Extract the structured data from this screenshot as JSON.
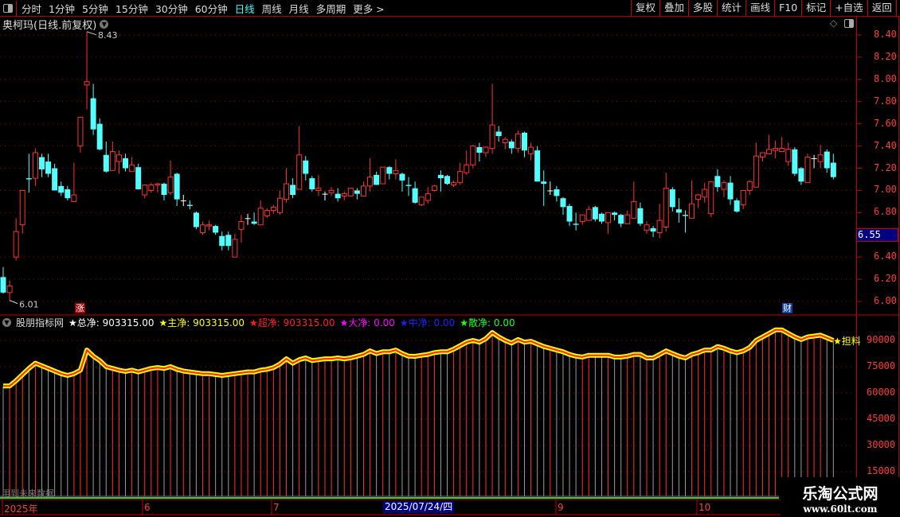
{
  "toolbar": {
    "periods": [
      "分时",
      "1分钟",
      "5分钟",
      "15分钟",
      "30分钟",
      "60分钟",
      "日线",
      "周线",
      "月线",
      "多周期",
      "更多 >"
    ],
    "active_period": "日线",
    "buttons": [
      "复权",
      "叠加",
      "多股",
      "统计",
      "画线",
      "F10",
      "标记",
      "+自选",
      "返回"
    ]
  },
  "chart": {
    "title": "奥柯玛(日线.前复权)",
    "high_marker": "8.43",
    "low_marker": "6.01",
    "signal_up": "涨",
    "signal_fin": "财",
    "current_price_label": "6.55",
    "price_ticks": [
      "8.40",
      "8.20",
      "8.00",
      "7.80",
      "7.60",
      "7.40",
      "7.20",
      "7.00",
      "6.80",
      "6.40",
      "6.20",
      "6.00"
    ],
    "colors": {
      "up": "#ff3232",
      "down": "#54ffff",
      "doji": "#ffffff",
      "grid": "#a00000",
      "axis": "#c00000"
    }
  },
  "indicator": {
    "name": "股朋指标网",
    "fields": [
      {
        "label": "★总净:",
        "value": "903315.00",
        "color": "#ffffff"
      },
      {
        "label": "★主净:",
        "value": "903315.00",
        "color": "#ffff00"
      },
      {
        "label": "★超净:",
        "value": "903315.00",
        "color": "#ff2020"
      },
      {
        "label": "★大净:",
        "value": "0.00",
        "color": "#ff00ff"
      },
      {
        "label": "★中净:",
        "value": "0.00",
        "color": "#2020ff"
      },
      {
        "label": "★散净:",
        "value": "0.00",
        "color": "#20ff20"
      }
    ],
    "end_label": "★担料",
    "ticks": [
      "90000",
      "75000",
      "60000",
      "45000",
      "30000",
      "15000"
    ],
    "note": "用到未来数据"
  },
  "date_axis": {
    "labels": [
      "2025年",
      "6",
      "7",
      "9",
      "10"
    ],
    "cursor_date": "2025/07/24/四"
  },
  "watermark": {
    "name": "乐淘公式网",
    "url": "www.60lt.com"
  },
  "chart_data": {
    "type": "candlestick",
    "price_range": [
      5.95,
      8.55
    ],
    "ohlc": [
      [
        6.22,
        6.31,
        6.07,
        6.08
      ],
      [
        6.08,
        6.19,
        6.01,
        6.14
      ],
      [
        6.4,
        6.75,
        6.37,
        6.63
      ],
      [
        6.69,
        7.0,
        6.61,
        7.0
      ],
      [
        7.11,
        7.33,
        6.98,
        7.1
      ],
      [
        7.11,
        7.38,
        7.04,
        7.34
      ],
      [
        7.3,
        7.33,
        7.12,
        7.19
      ],
      [
        7.26,
        7.33,
        7.12,
        7.15
      ],
      [
        7.2,
        7.24,
        7.0,
        7.0
      ],
      [
        7.04,
        7.08,
        6.95,
        6.98
      ],
      [
        7.01,
        7.04,
        6.91,
        6.93
      ],
      [
        6.9,
        7.25,
        6.9,
        6.96
      ],
      [
        7.4,
        7.66,
        7.34,
        7.66
      ],
      [
        7.95,
        8.43,
        7.73,
        7.98
      ],
      [
        7.83,
        7.96,
        7.5,
        7.55
      ],
      [
        7.6,
        7.65,
        7.36,
        7.37
      ],
      [
        7.32,
        7.44,
        7.16,
        7.17
      ],
      [
        7.18,
        7.44,
        7.18,
        7.35
      ],
      [
        7.26,
        7.36,
        7.15,
        7.32
      ],
      [
        7.29,
        7.33,
        7.17,
        7.2
      ],
      [
        7.17,
        7.3,
        7.17,
        7.23
      ],
      [
        7.21,
        7.24,
        7.01,
        7.01
      ],
      [
        6.96,
        7.05,
        6.93,
        7.05
      ],
      [
        7.0,
        7.07,
        6.98,
        7.05
      ],
      [
        7.05,
        7.07,
        6.98,
        7.06
      ],
      [
        7.06,
        7.07,
        6.91,
        6.96
      ],
      [
        6.98,
        7.27,
        6.96,
        7.12
      ],
      [
        7.15,
        7.16,
        6.86,
        6.92
      ],
      [
        6.91,
        6.96,
        6.86,
        6.91
      ],
      [
        6.87,
        6.91,
        6.83,
        6.86
      ],
      [
        6.8,
        6.81,
        6.65,
        6.67
      ],
      [
        6.62,
        6.72,
        6.6,
        6.69
      ],
      [
        6.68,
        6.73,
        6.64,
        6.69
      ],
      [
        6.68,
        6.69,
        6.6,
        6.62
      ],
      [
        6.59,
        6.63,
        6.46,
        6.5
      ],
      [
        6.6,
        6.63,
        6.46,
        6.5
      ],
      [
        6.4,
        6.61,
        6.4,
        6.56
      ],
      [
        6.65,
        6.78,
        6.53,
        6.72
      ],
      [
        6.75,
        6.79,
        6.69,
        6.75
      ],
      [
        6.72,
        6.8,
        6.69,
        6.7
      ],
      [
        6.69,
        6.91,
        6.69,
        6.84
      ],
      [
        6.77,
        6.84,
        6.75,
        6.82
      ],
      [
        6.82,
        6.87,
        6.79,
        6.85
      ],
      [
        6.8,
        7.0,
        6.78,
        6.93
      ],
      [
        6.92,
        7.2,
        6.89,
        7.06
      ],
      [
        7.05,
        7.11,
        6.93,
        6.96
      ],
      [
        7.01,
        7.58,
        7.01,
        7.32
      ],
      [
        7.27,
        7.31,
        7.09,
        7.15
      ],
      [
        7.11,
        7.13,
        6.99,
        7.01
      ],
      [
        7.0,
        7.14,
        6.95,
        7.02
      ],
      [
        6.97,
        6.99,
        6.91,
        6.97
      ],
      [
        6.98,
        7.03,
        6.95,
        7.0
      ],
      [
        6.97,
        7.02,
        6.9,
        6.93
      ],
      [
        6.95,
        6.99,
        6.91,
        6.97
      ],
      [
        6.95,
        7.02,
        6.95,
        7.02
      ],
      [
        7.0,
        7.02,
        6.92,
        6.97
      ],
      [
        6.95,
        7.08,
        6.95,
        7.04
      ],
      [
        7.04,
        7.29,
        6.99,
        7.12
      ],
      [
        7.14,
        7.17,
        7.05,
        7.05
      ],
      [
        7.06,
        7.21,
        7.06,
        7.21
      ],
      [
        7.21,
        7.22,
        7.1,
        7.15
      ],
      [
        7.15,
        7.28,
        7.1,
        7.18
      ],
      [
        7.15,
        7.16,
        6.99,
        7.09
      ],
      [
        7.05,
        7.12,
        6.95,
        7.04
      ],
      [
        7.02,
        7.08,
        6.88,
        6.89
      ],
      [
        6.87,
        6.94,
        6.86,
        6.94
      ],
      [
        6.91,
        7.03,
        6.88,
        6.97
      ],
      [
        7.0,
        7.05,
        6.99,
        7.04
      ],
      [
        7.14,
        7.18,
        6.99,
        7.11
      ],
      [
        7.13,
        7.14,
        7.05,
        7.06
      ],
      [
        7.05,
        7.09,
        7.03,
        7.07
      ],
      [
        7.07,
        7.25,
        7.05,
        7.17
      ],
      [
        7.16,
        7.36,
        7.14,
        7.23
      ],
      [
        7.23,
        7.41,
        7.2,
        7.4
      ],
      [
        7.39,
        7.43,
        7.26,
        7.34
      ],
      [
        7.34,
        7.4,
        7.3,
        7.39
      ],
      [
        7.38,
        7.96,
        7.33,
        7.59
      ],
      [
        7.53,
        7.58,
        7.44,
        7.49
      ],
      [
        7.43,
        7.48,
        7.37,
        7.46
      ],
      [
        7.44,
        7.46,
        7.33,
        7.38
      ],
      [
        7.38,
        7.54,
        7.34,
        7.51
      ],
      [
        7.52,
        7.53,
        7.3,
        7.36
      ],
      [
        7.33,
        7.43,
        7.27,
        7.39
      ],
      [
        7.36,
        7.4,
        7.08,
        7.08
      ],
      [
        7.08,
        7.18,
        6.86,
        7.06
      ],
      [
        7.0,
        7.08,
        6.96,
        7.0
      ],
      [
        7.01,
        7.04,
        6.9,
        6.95
      ],
      [
        6.93,
        6.94,
        6.78,
        6.85
      ],
      [
        6.86,
        6.88,
        6.68,
        6.72
      ],
      [
        6.7,
        6.8,
        6.64,
        6.69
      ],
      [
        6.72,
        6.78,
        6.69,
        6.78
      ],
      [
        6.73,
        6.86,
        6.73,
        6.83
      ],
      [
        6.85,
        6.86,
        6.72,
        6.74
      ],
      [
        6.79,
        6.8,
        6.7,
        6.72
      ],
      [
        6.71,
        6.8,
        6.61,
        6.8
      ],
      [
        6.8,
        6.81,
        6.73,
        6.78
      ],
      [
        6.78,
        6.79,
        6.67,
        6.7
      ],
      [
        6.7,
        6.82,
        6.7,
        6.78
      ],
      [
        6.75,
        7.08,
        6.75,
        6.9
      ],
      [
        6.84,
        6.89,
        6.68,
        6.7
      ],
      [
        6.64,
        6.72,
        6.61,
        6.69
      ],
      [
        6.66,
        6.68,
        6.58,
        6.63
      ],
      [
        6.62,
        6.88,
        6.57,
        6.73
      ],
      [
        6.67,
        7.16,
        6.63,
        7.02
      ],
      [
        7.01,
        7.03,
        6.81,
        6.85
      ],
      [
        6.83,
        6.93,
        6.71,
        6.8
      ],
      [
        6.78,
        6.82,
        6.62,
        6.77
      ],
      [
        6.75,
        7.09,
        6.75,
        6.88
      ],
      [
        6.92,
        6.97,
        6.84,
        6.96
      ],
      [
        6.94,
        7.07,
        6.89,
        7.01
      ],
      [
        6.79,
        7.08,
        6.76,
        7.08
      ],
      [
        7.13,
        7.19,
        6.99,
        7.03
      ],
      [
        7.01,
        7.09,
        6.94,
        7.07
      ],
      [
        7.07,
        7.13,
        6.87,
        6.92
      ],
      [
        6.91,
        6.93,
        6.8,
        6.81
      ],
      [
        6.87,
        7.0,
        6.83,
        7.0
      ],
      [
        7.0,
        7.09,
        6.96,
        7.08
      ],
      [
        7.03,
        7.43,
        7.03,
        7.31
      ],
      [
        7.3,
        7.34,
        7.26,
        7.34
      ],
      [
        7.33,
        7.5,
        7.33,
        7.37
      ],
      [
        7.36,
        7.45,
        7.29,
        7.38
      ],
      [
        7.35,
        7.48,
        7.35,
        7.38
      ],
      [
        7.26,
        7.43,
        7.22,
        7.37
      ],
      [
        7.37,
        7.39,
        7.13,
        7.15
      ],
      [
        7.2,
        7.21,
        7.05,
        7.08
      ],
      [
        7.07,
        7.33,
        7.07,
        7.3
      ],
      [
        7.29,
        7.32,
        7.2,
        7.29
      ],
      [
        7.26,
        7.41,
        7.2,
        7.32
      ],
      [
        7.35,
        7.37,
        7.16,
        7.2
      ],
      [
        7.25,
        7.33,
        7.1,
        7.12
      ]
    ],
    "indicator_values": [
      64000,
      64000,
      67000,
      70500,
      74000,
      77000,
      75500,
      74000,
      72500,
      71000,
      70000,
      71000,
      73000,
      84500,
      81000,
      78500,
      75000,
      74000,
      73000,
      72300,
      73000,
      72000,
      73000,
      74000,
      74500,
      74000,
      75000,
      73500,
      72500,
      72000,
      71500,
      71000,
      71000,
      70500,
      70000,
      70500,
      71000,
      71500,
      72000,
      72000,
      73000,
      73500,
      74500,
      76500,
      79500,
      77000,
      79000,
      80000,
      78500,
      79000,
      79500,
      79500,
      80000,
      79500,
      80000,
      81000,
      82000,
      84000,
      82500,
      83500,
      83500,
      84500,
      82500,
      81000,
      80900,
      81500,
      82000,
      83000,
      83500,
      83500,
      85000,
      87000,
      89000,
      90000,
      89000,
      91000,
      94500,
      92000,
      90000,
      88500,
      90500,
      89000,
      89500,
      88000,
      86500,
      85500,
      84500,
      83500,
      82000,
      81000,
      80500,
      81500,
      81500,
      81500,
      81500,
      80500,
      80500,
      81000,
      82000,
      82000,
      80000,
      80000,
      82000,
      84000,
      82500,
      81000,
      80000,
      82000,
      83000,
      84500,
      84500,
      86500,
      85500,
      84000,
      83000,
      84000,
      86000,
      90000,
      92000,
      94000,
      96000,
      96000,
      94000,
      92000,
      90500,
      92000,
      92500,
      93000,
      91500,
      90000
    ],
    "indicator_range": [
      0,
      100000
    ]
  }
}
